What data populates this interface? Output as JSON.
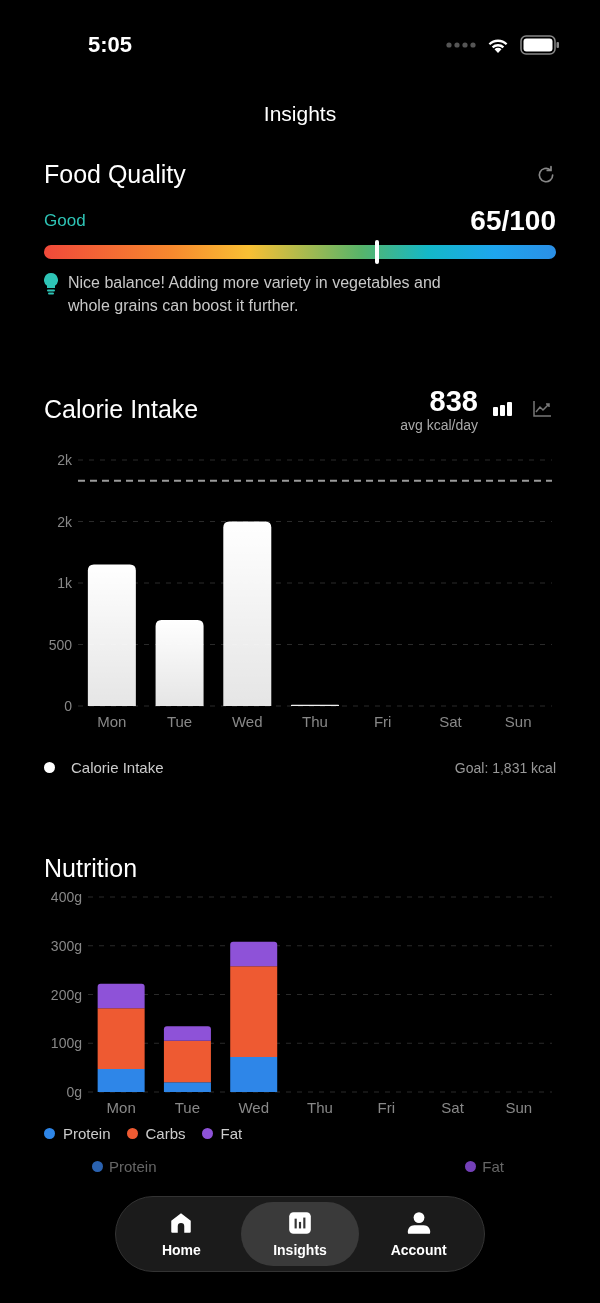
{
  "status_bar": {
    "time": "5:05"
  },
  "header": {
    "title": "Insights"
  },
  "food_quality": {
    "title": "Food Quality",
    "rating": "Good",
    "score": "65/100",
    "level": 0.65,
    "tip": "Nice balance! Adding more variety in vegetables and whole grains can boost it further."
  },
  "calorie_intake": {
    "title": "Calorie Intake",
    "average": "838",
    "average_label": "avg kcal/day",
    "view_toggles": [
      {
        "kind": "bar",
        "selected": true
      },
      {
        "kind": "line",
        "selected": false
      }
    ],
    "chart_data": {
      "type": "bar",
      "categories": [
        "Mon",
        "Tue",
        "Wed",
        "Thu",
        "Fri",
        "Sat",
        "Sun"
      ],
      "grid": true,
      "series": [
        {
          "name": "Calorie Intake",
          "color": "#ffffff",
          "values": [
            1150,
            700,
            1500,
            10,
            null,
            null,
            null
          ]
        }
      ],
      "ylim": [
        0,
        2000
      ],
      "yticks": [
        0,
        500,
        {
          "value": 1000,
          "label": "1k"
        },
        {
          "value": 1500,
          "label": "2k"
        },
        {
          "value": 2000,
          "label": "2k"
        }
      ],
      "ref_lines": [
        {
          "axis": "y",
          "value": 1831
        }
      ]
    },
    "goal": "Goal: 1,831 kcal"
  },
  "nutrition": {
    "title": "Nutrition",
    "chart_data": {
      "type": "bar",
      "stacked": true,
      "grid": true,
      "categories": [
        "Mon",
        "Tue",
        "Wed",
        "Thu",
        "Fri",
        "Sat",
        "Sun"
      ],
      "series": [
        {
          "name": "Protein",
          "color": "#2e86e8",
          "values": [
            47,
            20,
            72,
            null,
            null,
            null,
            null
          ]
        },
        {
          "name": "Carbs",
          "color": "#ee5a32",
          "values": [
            125,
            85,
            186,
            null,
            null,
            null,
            null
          ]
        },
        {
          "name": "Fat",
          "color": "#8e52d8",
          "values": [
            50,
            30,
            50,
            null,
            null,
            null,
            null
          ]
        }
      ],
      "ylim": [
        0,
        400
      ],
      "yticks": [
        {
          "value": 0,
          "label": "0g"
        },
        {
          "value": 100,
          "label": "100g"
        },
        {
          "value": 200,
          "label": "200g"
        },
        {
          "value": 300,
          "label": "300g"
        },
        {
          "value": 400,
          "label": "400g"
        }
      ]
    }
  },
  "macro_summary": [
    {
      "name": "Protein",
      "color": "#2a62b0"
    },
    {
      "name": "Fat",
      "color": "#7440b8"
    }
  ],
  "tab_bar": [
    {
      "label": "Home",
      "kind": "home",
      "selected": false
    },
    {
      "label": "Insights",
      "kind": "insights",
      "selected": true
    },
    {
      "label": "Account",
      "kind": "account",
      "selected": false
    }
  ]
}
